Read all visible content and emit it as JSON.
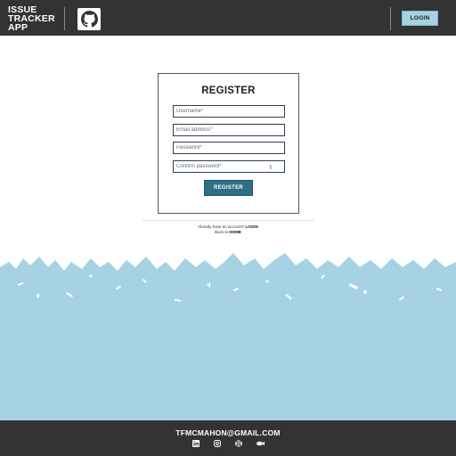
{
  "header": {
    "app_title": "ISSUE\nTRACKER\nAPP",
    "github_icon": "github-icon",
    "login_label": "LOGIN"
  },
  "register": {
    "title": "REGISTER",
    "username_placeholder": "Username*",
    "email_placeholder": "Email address*",
    "password_placeholder": "Password*",
    "confirm_placeholder": "Confirm password*",
    "submit_label": "REGISTER"
  },
  "links": {
    "already_text": "Already have an account?",
    "login_link": "LOGIN",
    "back_text": "Back to",
    "home_link": "HOME"
  },
  "footer": {
    "email": "TFMCMAHON@GMAIL.COM",
    "social_icons": [
      "linkedin-icon",
      "instagram-icon",
      "codepen-icon",
      "fish-icon"
    ]
  },
  "colors": {
    "dark_bar": "#333333",
    "accent_light_blue": "#a6d2e4",
    "button_teal": "#2e6f86",
    "background": "#ffffff"
  }
}
